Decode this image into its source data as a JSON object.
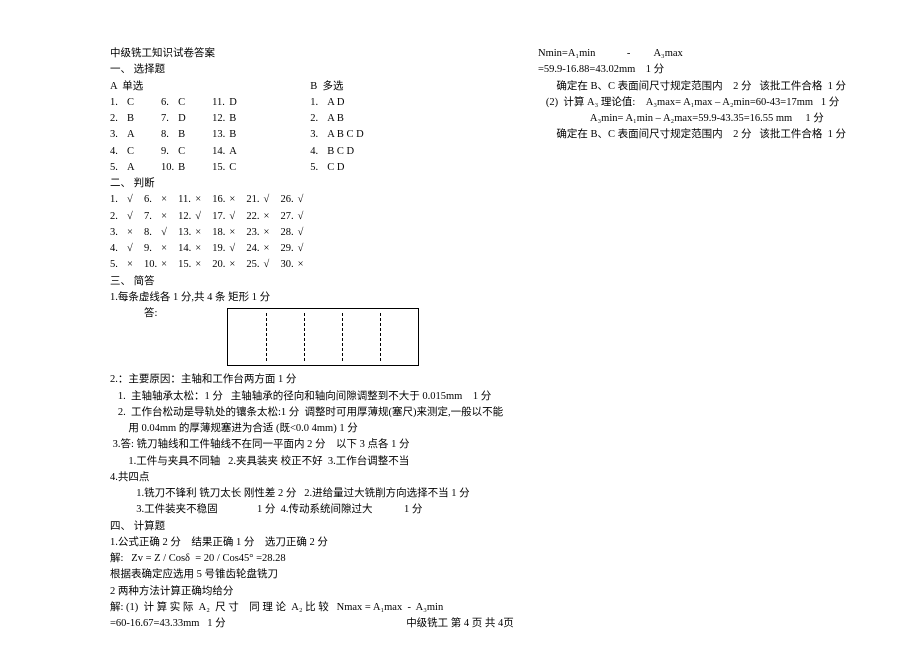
{
  "title": "中级铣工知识试卷答案",
  "sec1_heading": "一、 选择题",
  "label_A": "A  单选",
  "label_B": "B  多选",
  "singleA": [
    [
      "1.",
      "C",
      "",
      "6.",
      "C",
      "",
      "11.",
      "D"
    ],
    [
      "2.",
      "B",
      "",
      "7.",
      "D",
      "",
      "12.",
      "B"
    ],
    [
      "3.",
      "A",
      "",
      "8.",
      "B",
      "",
      "13.",
      "B"
    ],
    [
      "4.",
      "C",
      "",
      "9.",
      "C",
      "",
      "14.",
      "A"
    ],
    [
      "5.",
      "A",
      "",
      "10.",
      "B",
      "",
      "15.",
      "C"
    ]
  ],
  "multiB": [
    [
      "1.",
      "A D"
    ],
    [
      "2.",
      "A B"
    ],
    [
      "3.",
      "A B C D"
    ],
    [
      "4.",
      "B C D"
    ],
    [
      "5.",
      "C D"
    ]
  ],
  "sec2_heading": "二、 判断",
  "judge": [
    [
      "1.",
      "√",
      "6.",
      "×",
      "11.",
      "×",
      "16.",
      "×",
      "21.",
      "√",
      "26.",
      "√"
    ],
    [
      "2.",
      "√",
      "7.",
      "×",
      "12.",
      "√",
      "17.",
      "√",
      "22.",
      "×",
      "27.",
      "√"
    ],
    [
      "3.",
      "×",
      "8.",
      "√",
      "13.",
      "×",
      "18.",
      "×",
      "23.",
      "×",
      "28.",
      "√"
    ],
    [
      "4.",
      "√",
      "9.",
      "×",
      "14.",
      "×",
      "19.",
      "√",
      "24.",
      "×",
      "29.",
      "√"
    ],
    [
      "5.",
      "×",
      "10.",
      "×",
      "15.",
      "×",
      "20.",
      "×",
      "25.",
      "√",
      "30.",
      "×"
    ]
  ],
  "sec3_heading": "三、 简答",
  "q3_1": "1.每条虚线各 1 分,共 4 条 矩形 1 分",
  "q3_1_ans_label": "答:",
  "q3_2_lines": [
    "2.：主要原因：主轴和工作台两方面 1 分",
    "   1.  主轴轴承太松：1 分   主轴轴承的径向和轴向间隙调整到不大于 0.015mm    1 分",
    "   2.  工作台松动是导轨处的镶条太松:1 分  调整时可用厚薄规(塞尺)来测定,一般以不能",
    "       用 0.04mm 的厚薄规塞进为合适 (既<0.0 4mm) 1 分"
  ],
  "q3_3_lines": [
    " 3.答: 铣刀轴线和工件轴线不在同一平面内 2 分    以下 3 点各 1 分",
    "       1.工件与夹具不同轴   2.夹具装夹 校正不好  3.工作台调整不当"
  ],
  "q3_4_lines": [
    "4.共四点",
    "          1.铣刀不锋利 铣刀太长 刚性差 2 分   2.进给量过大铣削方向选择不当 1 分",
    "          3.工件装夹不稳固               1 分  4.传动系统间隙过大            1 分"
  ],
  "sec4_heading": "四、 计算题",
  "calc_lines": [
    "1.公式正确 2 分    结果正确 1 分    选刀正确 2 分",
    "解:   Zv = Z / Cosδ  = 20 / Cos45° =28.28",
    "根据表确定应选用 5 号锥齿轮盘铣刀",
    "2 两种方法计算正确均给分",
    "解: (1)  计 算 实 际  A₂  尺 寸    同 理 论  A₂ 比 较   Nmax = A₁max  -  A₃min",
    "=60-16.67=43.33mm   1 分"
  ],
  "right_lines": [
    "Nmin=A₁min            -         A₃max",
    "=59.9-16.88=43.02mm    1 分",
    "       确定在 B、C 表面间尺寸规定范围内    2 分   该批工件合格  1 分",
    "   (2)  计算 A₃ 理论值:    A₃max= A₁max – A₂min=60-43=17mm   1 分",
    "                    A₃min= A₁min – A₂max=59.9-43.35=16.55 mm     1 分",
    "       确定在 B、C 表面间尺寸规定范围内    2 分   该批工件合格  1 分"
  ],
  "footer": "中级铣工    第  4  页 共  4页"
}
